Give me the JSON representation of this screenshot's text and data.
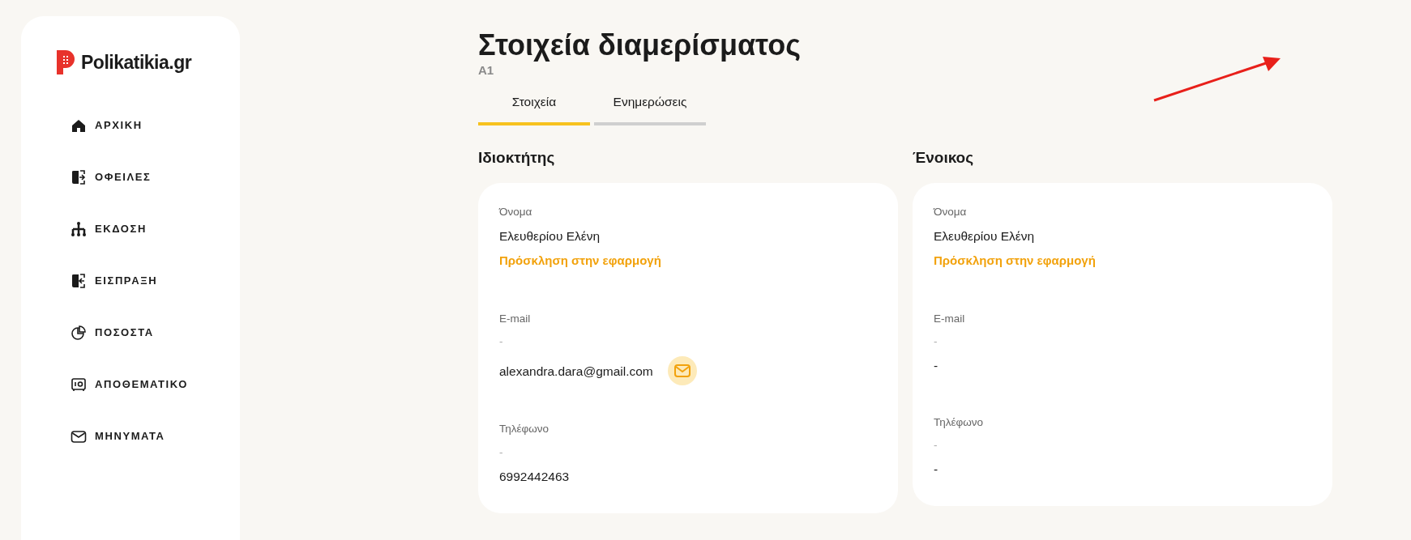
{
  "sidebar": {
    "logo_text": "Polikatikia.gr",
    "items": [
      {
        "label": "ΑΡΧΙΚΗ"
      },
      {
        "label": "ΟΦΕΙΛΕΣ"
      },
      {
        "label": "ΕΚΔΟΣΗ"
      },
      {
        "label": "ΕΙΣΠΡΑΞΗ"
      },
      {
        "label": "ΠΟΣΟΣΤΑ"
      },
      {
        "label": "ΑΠΟΘΕΜΑΤΙΚΟ"
      },
      {
        "label": "ΜΗΝΥΜΑΤΑ"
      }
    ]
  },
  "header": {
    "title": "Στοιχεία διαμερίσματος",
    "subtitle": "A1"
  },
  "tabs": [
    {
      "label": "Στοιχεία",
      "selected": true
    },
    {
      "label": "Ενημερώσεις",
      "selected": false
    }
  ],
  "sections": [
    {
      "heading": "Ιδιοκτήτης",
      "name_label": "Όνομα",
      "name": "Ελευθερίου Ελένη",
      "invite_link": "Πρόσκληση στην εφαρμογή",
      "email_label": "E-mail",
      "email_hint": "-",
      "email": "alexandra.dara@gmail.com",
      "mail_button": true,
      "phone_label": "Τηλέφωνο",
      "phone_hint": "-",
      "phone": "6992442463"
    },
    {
      "heading": "Ένοικος",
      "name_label": "Όνομα",
      "name": "Ελευθερίου Ελένη",
      "invite_link": "Πρόσκληση στην εφαρμογή",
      "email_label": "E-mail",
      "email_hint": "-",
      "email": "-",
      "mail_button": false,
      "phone_label": "Τηλέφωνο",
      "phone_hint": "-",
      "phone": "-"
    }
  ]
}
